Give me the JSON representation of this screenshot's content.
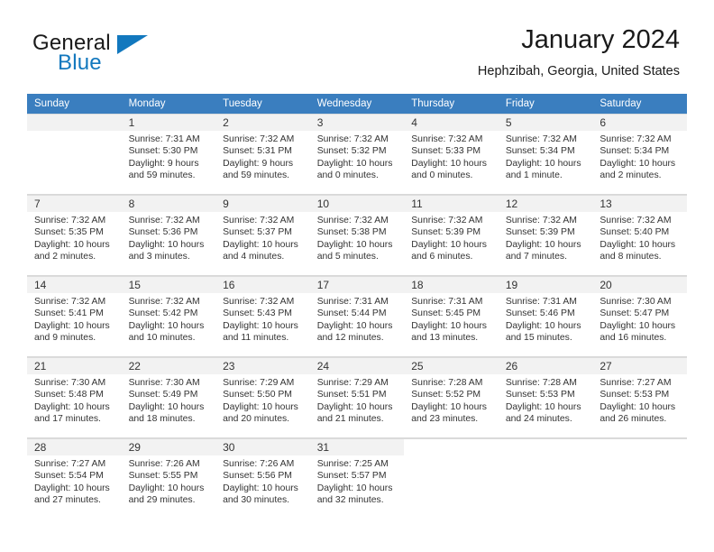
{
  "brand": {
    "line1": "General",
    "line2": "Blue",
    "accent_color": "#1278be",
    "triangle_icon": "brand-triangle-icon"
  },
  "header": {
    "month_title": "January 2024",
    "location": "Hephzibah, Georgia, United States"
  },
  "calendar": {
    "header_color": "#3a7ebf",
    "weekday_headers": [
      "Sunday",
      "Monday",
      "Tuesday",
      "Wednesday",
      "Thursday",
      "Friday",
      "Saturday"
    ],
    "weeks": [
      [
        {
          "day": "",
          "empty": true
        },
        {
          "day": "1",
          "sunrise": "Sunrise: 7:31 AM",
          "sunset": "Sunset: 5:30 PM",
          "daylight1": "Daylight: 9 hours",
          "daylight2": "and 59 minutes."
        },
        {
          "day": "2",
          "sunrise": "Sunrise: 7:32 AM",
          "sunset": "Sunset: 5:31 PM",
          "daylight1": "Daylight: 9 hours",
          "daylight2": "and 59 minutes."
        },
        {
          "day": "3",
          "sunrise": "Sunrise: 7:32 AM",
          "sunset": "Sunset: 5:32 PM",
          "daylight1": "Daylight: 10 hours",
          "daylight2": "and 0 minutes."
        },
        {
          "day": "4",
          "sunrise": "Sunrise: 7:32 AM",
          "sunset": "Sunset: 5:33 PM",
          "daylight1": "Daylight: 10 hours",
          "daylight2": "and 0 minutes."
        },
        {
          "day": "5",
          "sunrise": "Sunrise: 7:32 AM",
          "sunset": "Sunset: 5:34 PM",
          "daylight1": "Daylight: 10 hours",
          "daylight2": "and 1 minute."
        },
        {
          "day": "6",
          "sunrise": "Sunrise: 7:32 AM",
          "sunset": "Sunset: 5:34 PM",
          "daylight1": "Daylight: 10 hours",
          "daylight2": "and 2 minutes."
        }
      ],
      [
        {
          "day": "7",
          "sunrise": "Sunrise: 7:32 AM",
          "sunset": "Sunset: 5:35 PM",
          "daylight1": "Daylight: 10 hours",
          "daylight2": "and 2 minutes."
        },
        {
          "day": "8",
          "sunrise": "Sunrise: 7:32 AM",
          "sunset": "Sunset: 5:36 PM",
          "daylight1": "Daylight: 10 hours",
          "daylight2": "and 3 minutes."
        },
        {
          "day": "9",
          "sunrise": "Sunrise: 7:32 AM",
          "sunset": "Sunset: 5:37 PM",
          "daylight1": "Daylight: 10 hours",
          "daylight2": "and 4 minutes."
        },
        {
          "day": "10",
          "sunrise": "Sunrise: 7:32 AM",
          "sunset": "Sunset: 5:38 PM",
          "daylight1": "Daylight: 10 hours",
          "daylight2": "and 5 minutes."
        },
        {
          "day": "11",
          "sunrise": "Sunrise: 7:32 AM",
          "sunset": "Sunset: 5:39 PM",
          "daylight1": "Daylight: 10 hours",
          "daylight2": "and 6 minutes."
        },
        {
          "day": "12",
          "sunrise": "Sunrise: 7:32 AM",
          "sunset": "Sunset: 5:39 PM",
          "daylight1": "Daylight: 10 hours",
          "daylight2": "and 7 minutes."
        },
        {
          "day": "13",
          "sunrise": "Sunrise: 7:32 AM",
          "sunset": "Sunset: 5:40 PM",
          "daylight1": "Daylight: 10 hours",
          "daylight2": "and 8 minutes."
        }
      ],
      [
        {
          "day": "14",
          "sunrise": "Sunrise: 7:32 AM",
          "sunset": "Sunset: 5:41 PM",
          "daylight1": "Daylight: 10 hours",
          "daylight2": "and 9 minutes."
        },
        {
          "day": "15",
          "sunrise": "Sunrise: 7:32 AM",
          "sunset": "Sunset: 5:42 PM",
          "daylight1": "Daylight: 10 hours",
          "daylight2": "and 10 minutes."
        },
        {
          "day": "16",
          "sunrise": "Sunrise: 7:32 AM",
          "sunset": "Sunset: 5:43 PM",
          "daylight1": "Daylight: 10 hours",
          "daylight2": "and 11 minutes."
        },
        {
          "day": "17",
          "sunrise": "Sunrise: 7:31 AM",
          "sunset": "Sunset: 5:44 PM",
          "daylight1": "Daylight: 10 hours",
          "daylight2": "and 12 minutes."
        },
        {
          "day": "18",
          "sunrise": "Sunrise: 7:31 AM",
          "sunset": "Sunset: 5:45 PM",
          "daylight1": "Daylight: 10 hours",
          "daylight2": "and 13 minutes."
        },
        {
          "day": "19",
          "sunrise": "Sunrise: 7:31 AM",
          "sunset": "Sunset: 5:46 PM",
          "daylight1": "Daylight: 10 hours",
          "daylight2": "and 15 minutes."
        },
        {
          "day": "20",
          "sunrise": "Sunrise: 7:30 AM",
          "sunset": "Sunset: 5:47 PM",
          "daylight1": "Daylight: 10 hours",
          "daylight2": "and 16 minutes."
        }
      ],
      [
        {
          "day": "21",
          "sunrise": "Sunrise: 7:30 AM",
          "sunset": "Sunset: 5:48 PM",
          "daylight1": "Daylight: 10 hours",
          "daylight2": "and 17 minutes."
        },
        {
          "day": "22",
          "sunrise": "Sunrise: 7:30 AM",
          "sunset": "Sunset: 5:49 PM",
          "daylight1": "Daylight: 10 hours",
          "daylight2": "and 18 minutes."
        },
        {
          "day": "23",
          "sunrise": "Sunrise: 7:29 AM",
          "sunset": "Sunset: 5:50 PM",
          "daylight1": "Daylight: 10 hours",
          "daylight2": "and 20 minutes."
        },
        {
          "day": "24",
          "sunrise": "Sunrise: 7:29 AM",
          "sunset": "Sunset: 5:51 PM",
          "daylight1": "Daylight: 10 hours",
          "daylight2": "and 21 minutes."
        },
        {
          "day": "25",
          "sunrise": "Sunrise: 7:28 AM",
          "sunset": "Sunset: 5:52 PM",
          "daylight1": "Daylight: 10 hours",
          "daylight2": "and 23 minutes."
        },
        {
          "day": "26",
          "sunrise": "Sunrise: 7:28 AM",
          "sunset": "Sunset: 5:53 PM",
          "daylight1": "Daylight: 10 hours",
          "daylight2": "and 24 minutes."
        },
        {
          "day": "27",
          "sunrise": "Sunrise: 7:27 AM",
          "sunset": "Sunset: 5:53 PM",
          "daylight1": "Daylight: 10 hours",
          "daylight2": "and 26 minutes."
        }
      ],
      [
        {
          "day": "28",
          "sunrise": "Sunrise: 7:27 AM",
          "sunset": "Sunset: 5:54 PM",
          "daylight1": "Daylight: 10 hours",
          "daylight2": "and 27 minutes."
        },
        {
          "day": "29",
          "sunrise": "Sunrise: 7:26 AM",
          "sunset": "Sunset: 5:55 PM",
          "daylight1": "Daylight: 10 hours",
          "daylight2": "and 29 minutes."
        },
        {
          "day": "30",
          "sunrise": "Sunrise: 7:26 AM",
          "sunset": "Sunset: 5:56 PM",
          "daylight1": "Daylight: 10 hours",
          "daylight2": "and 30 minutes."
        },
        {
          "day": "31",
          "sunrise": "Sunrise: 7:25 AM",
          "sunset": "Sunset: 5:57 PM",
          "daylight1": "Daylight: 10 hours",
          "daylight2": "and 32 minutes."
        },
        {
          "day": "",
          "empty": true
        },
        {
          "day": "",
          "empty": true
        },
        {
          "day": "",
          "empty": true
        }
      ]
    ]
  }
}
